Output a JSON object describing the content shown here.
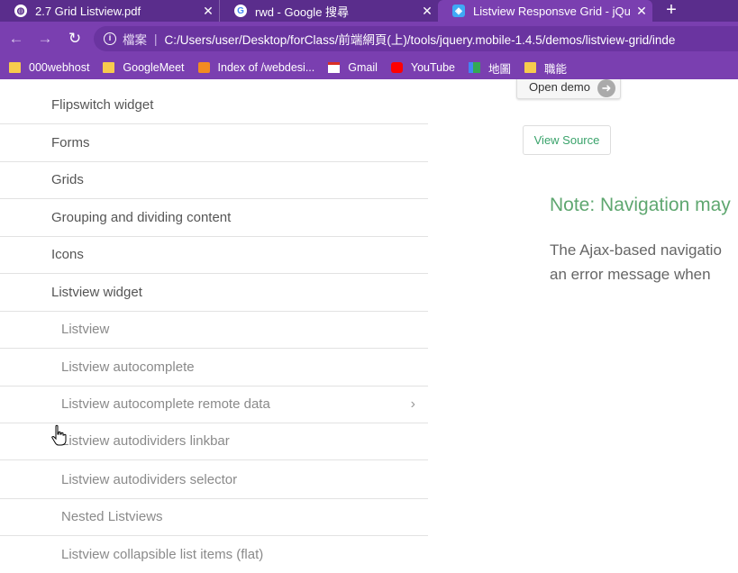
{
  "tabs": [
    {
      "title": "2.7 Grid Listview.pdf",
      "icon": "globe-icon"
    },
    {
      "title": "rwd - Google 搜尋",
      "icon": "google-icon"
    },
    {
      "title": "Listview Responsve Grid - jQue",
      "icon": "jquery-icon"
    }
  ],
  "toolbar": {
    "info_label": "檔案",
    "url": "C:/Users/user/Desktop/forClass/前端網頁(上)/tools/jquery.mobile-1.4.5/demos/listview-grid/inde"
  },
  "bookmarks": [
    {
      "label": "000webhost",
      "icon": "folder"
    },
    {
      "label": "GoogleMeet",
      "icon": "folder"
    },
    {
      "label": "Index of /webdesi...",
      "icon": "xampp"
    },
    {
      "label": "Gmail",
      "icon": "gmail"
    },
    {
      "label": "YouTube",
      "icon": "yt"
    },
    {
      "label": "地圖",
      "icon": "maps"
    },
    {
      "label": "職能",
      "icon": "folder"
    }
  ],
  "list": {
    "items": [
      {
        "label": "Flipswitch widget",
        "level": 1
      },
      {
        "label": "Forms",
        "level": 1
      },
      {
        "label": "Grids",
        "level": 1
      },
      {
        "label": "Grouping and dividing content",
        "level": 1
      },
      {
        "label": "Icons",
        "level": 1
      },
      {
        "label": "Listview widget",
        "level": 1
      },
      {
        "label": "Listview",
        "level": 2
      },
      {
        "label": "Listview autocomplete",
        "level": 2
      },
      {
        "label": "Listview autocomplete remote data",
        "level": 2
      },
      {
        "label": "Listview autodividers linkbar",
        "level": 2
      },
      {
        "label": "Listview autodividers selector",
        "level": 2
      },
      {
        "label": "Nested Listviews",
        "level": 2
      },
      {
        "label": "Listview collapsible list items (flat)",
        "level": 2
      }
    ]
  },
  "main": {
    "open_demo_label": "Open demo",
    "view_source_label": "View Source",
    "note_title": "Note: Navigation may",
    "para_line1": "The Ajax-based navigatio",
    "para_line2": "an error message when"
  }
}
